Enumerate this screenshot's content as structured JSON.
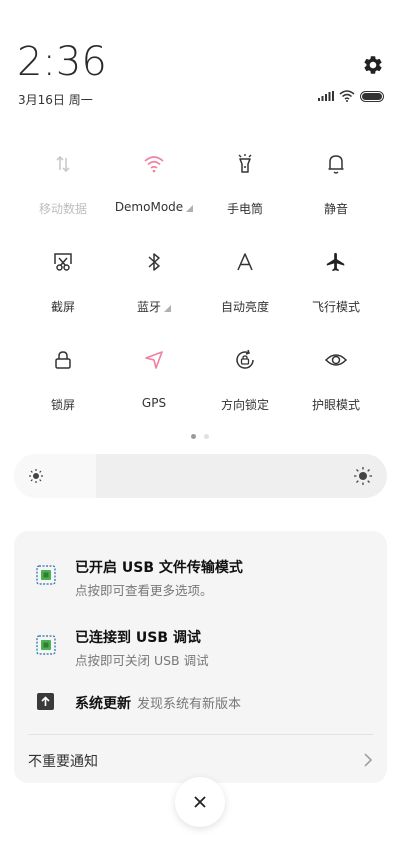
{
  "header": {
    "time": "2:36",
    "date": "3月16日 周一"
  },
  "tiles": [
    {
      "label": "移动数据",
      "icon": "mobile-data-icon",
      "active": false
    },
    {
      "label": "DemoMode",
      "icon": "wifi-icon",
      "active": true
    },
    {
      "label": "手电筒",
      "icon": "flashlight-icon",
      "active": false
    },
    {
      "label": "静音",
      "icon": "bell-icon",
      "active": false
    },
    {
      "label": "截屏",
      "icon": "screenshot-icon",
      "active": false
    },
    {
      "label": "蓝牙",
      "icon": "bluetooth-icon",
      "active": false
    },
    {
      "label": "自动亮度",
      "icon": "auto-brightness-icon",
      "active": false
    },
    {
      "label": "飞行模式",
      "icon": "airplane-icon",
      "active": false
    },
    {
      "label": "锁屏",
      "icon": "lock-icon",
      "active": false
    },
    {
      "label": "GPS",
      "icon": "gps-icon",
      "active": true
    },
    {
      "label": "方向锁定",
      "icon": "rotation-lock-icon",
      "active": false
    },
    {
      "label": "护眼模式",
      "icon": "eye-icon",
      "active": false
    }
  ],
  "pager": {
    "pages": 2,
    "current": 1
  },
  "brightness": {
    "level": 0.22
  },
  "notifications": [
    {
      "title": "已开启 USB 文件传输模式",
      "subtitle": "点按即可查看更多选项。",
      "icon": "usb-icon"
    },
    {
      "title": "已连接到 USB 调试",
      "subtitle": "点按即可关闭 USB 调试",
      "icon": "usb-icon"
    },
    {
      "title": "系统更新",
      "subtitle": "发现系统有新版本",
      "icon": "update-icon"
    }
  ],
  "minor_label": "不重要通知",
  "colors": {
    "accent_pink": "#f07fa0",
    "dim": "#bdbdbd",
    "usb_green": "#4caf50",
    "usb_border": "#1e6fa8"
  }
}
